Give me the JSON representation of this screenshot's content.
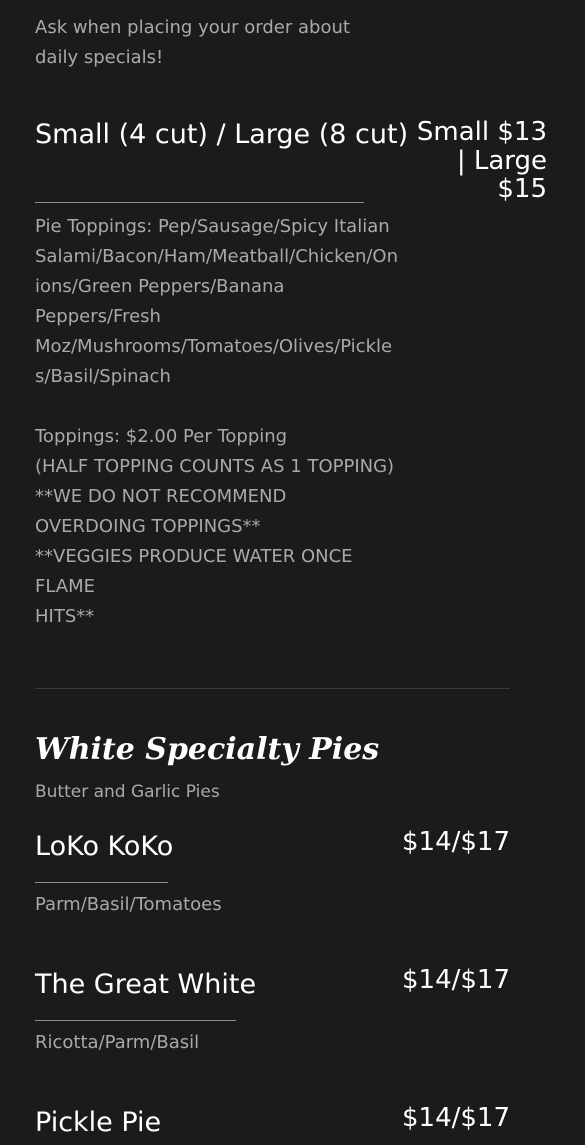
{
  "intro": {
    "lines": [
      "Ask when placing your order about",
      "daily specials!"
    ]
  },
  "size_item": {
    "title": "Small (4 cut) / Large (8 cut)",
    "price_lines": [
      "Small $13",
      "| Large",
      "$15"
    ],
    "toppings_lines": [
      "Pie Toppings: Pep/Sausage/Spicy Italian",
      "Salami/Bacon/Ham/Meatball/Chicken/On",
      "ions/Green Peppers/Banana",
      "Peppers/Fresh",
      "Moz/Mushrooms/Tomatoes/Olives/Pickle",
      "s/Basil/Spinach"
    ],
    "notes_lines": [
      "Toppings: $2.00 Per Topping",
      "(HALF TOPPING COUNTS AS 1 TOPPING)",
      "**WE  DO NOT RECOMMEND",
      "OVERDOING TOPPINGS**",
      "**VEGGIES PRODUCE WATER ONCE",
      "FLAME",
      "HITS**"
    ]
  },
  "white_section": {
    "heading": "White Specialty Pies",
    "subheading": "Butter and Garlic Pies",
    "items": [
      {
        "name": "LoKo KoKo",
        "price": "$14/$17",
        "description": "Parm/Basil/Tomatoes"
      },
      {
        "name": "The Great White",
        "price": "$14/$17",
        "description": "Ricotta/Parm/Basil"
      },
      {
        "name": "Pickle Pie",
        "price": "$14/$17"
      }
    ]
  },
  "colors": {
    "background": "#1b1b1c",
    "title_text": "#ffffff",
    "muted_text": "#a9a9a9"
  }
}
